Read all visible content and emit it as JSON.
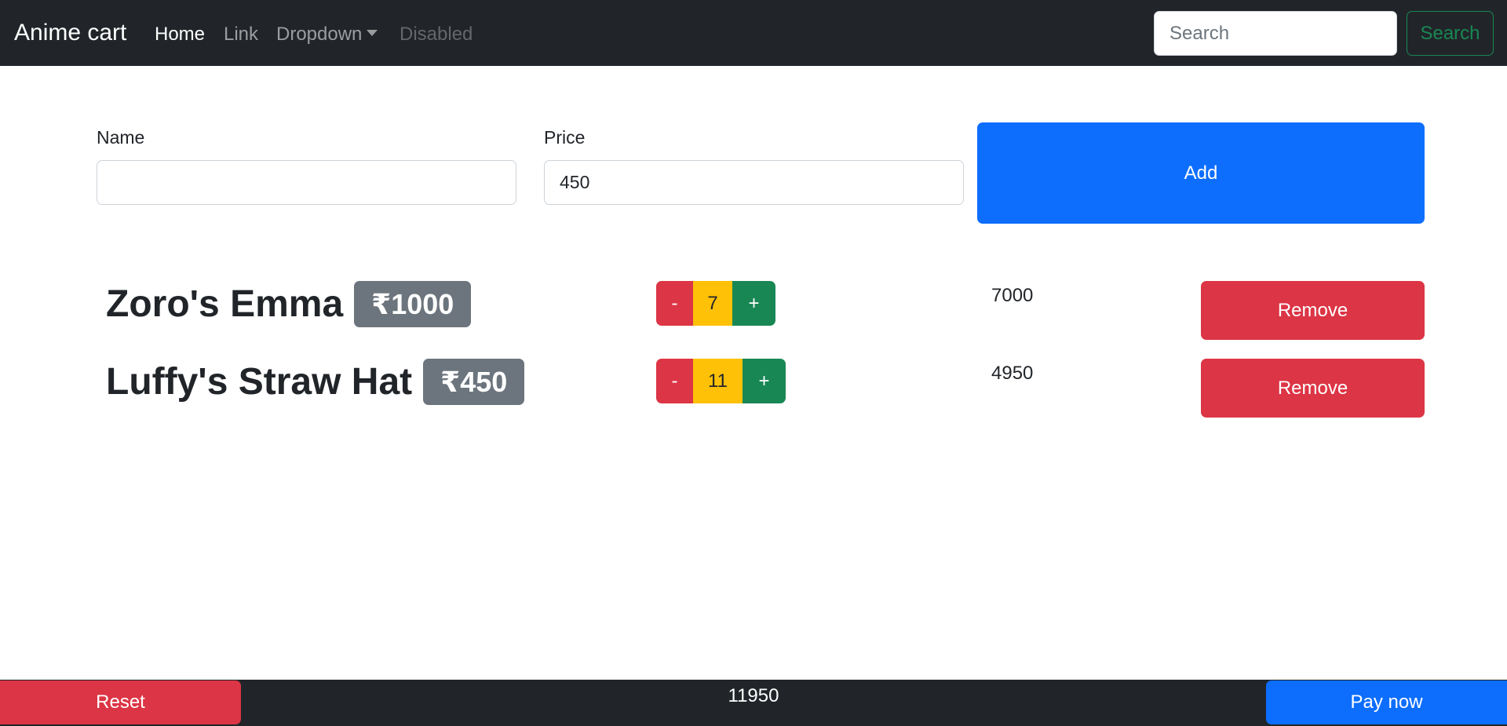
{
  "navbar": {
    "brand": "Anime cart",
    "links": [
      {
        "label": "Home",
        "state": "active"
      },
      {
        "label": "Link",
        "state": "normal"
      },
      {
        "label": "Dropdown",
        "state": "dropdown"
      },
      {
        "label": "Disabled",
        "state": "disabled"
      }
    ],
    "search_placeholder": "Search",
    "search_value": "",
    "search_button": "Search"
  },
  "form": {
    "name_label": "Name",
    "name_value": "",
    "price_label": "Price",
    "price_value": "450",
    "add_button": "Add"
  },
  "items": [
    {
      "name": "Zoro's Emma",
      "price": "₹1000",
      "minus": "-",
      "quantity": "7",
      "plus": "+",
      "subtotal": "7000",
      "remove": "Remove"
    },
    {
      "name": "Luffy's Straw Hat",
      "price": "₹450",
      "minus": "-",
      "quantity": "11",
      "plus": "+",
      "subtotal": "4950",
      "remove": "Remove"
    }
  ],
  "footer": {
    "reset_button": "Reset",
    "total": "11950",
    "pay_button": "Pay now"
  },
  "colors": {
    "navbar_bg": "#212529",
    "primary": "#0d6efd",
    "danger": "#dc3545",
    "warning": "#ffc107",
    "success": "#198754",
    "secondary": "#6c757d"
  }
}
